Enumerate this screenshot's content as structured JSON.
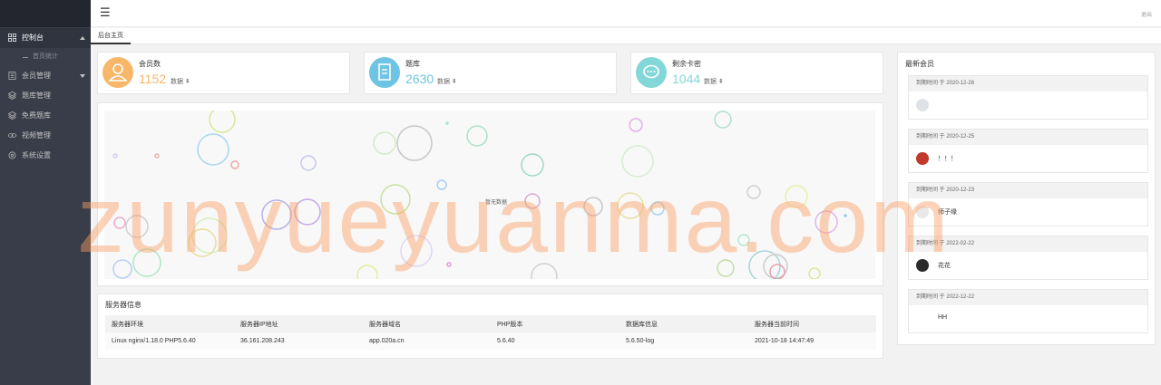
{
  "header": {
    "menu_icon": "☰",
    "logout_label": "退出"
  },
  "sidebar": {
    "items": [
      {
        "label": "控制台",
        "icon": "dashboard-icon",
        "active": true,
        "expanded": true
      },
      {
        "label": "会员管理",
        "icon": "users-icon",
        "expanded": false
      },
      {
        "label": "题库管理",
        "icon": "layers-icon"
      },
      {
        "label": "免费题库",
        "icon": "layers-icon"
      },
      {
        "label": "视频管理",
        "icon": "link-icon"
      },
      {
        "label": "系统设置",
        "icon": "gear-icon"
      }
    ],
    "sub_items": [
      {
        "label": "首页统计"
      }
    ]
  },
  "tabs": [
    {
      "label": "后台主页",
      "active": true
    }
  ],
  "stats": [
    {
      "title": "会员数",
      "value": "1152",
      "unit": "数据",
      "color": "#f7b668",
      "icon": "user-icon"
    },
    {
      "title": "题库",
      "value": "2630",
      "unit": "数据",
      "color": "#6ec4e3",
      "icon": "document-icon"
    },
    {
      "title": "剩余卡密",
      "value": "1044",
      "unit": "数据",
      "color": "#83d7d8",
      "icon": "chat-icon"
    }
  ],
  "chart": {
    "empty_text": "暂无数据"
  },
  "server": {
    "title": "服务器信息",
    "columns": [
      "服务器环境",
      "服务器IP地址",
      "服务器域名",
      "PHP版本",
      "数据库信息",
      "服务器当前时间"
    ],
    "row": [
      "Linux nginx/1.18.0 PHP5.6.40",
      "36.161.208.243",
      "app.020a.cn",
      "5.6.40",
      "5.6.50-log",
      "2021-10-18 14:47:49"
    ]
  },
  "latest_members": {
    "title": "最新会员",
    "items": [
      {
        "expire": "到期时间 于 2020-12-26",
        "name": "",
        "avatar_color": "#dfe3e8"
      },
      {
        "expire": "到期时间 于 2020-12-25",
        "name": "！！！",
        "avatar_color": "#c0392b"
      },
      {
        "expire": "到期时间 于 2020-12-23",
        "name": "师子缘",
        "avatar_color": "#e8e8e8"
      },
      {
        "expire": "到期时间 于 2022-02-22",
        "name": "花花",
        "avatar_color": "#2b2b2b"
      },
      {
        "expire": "到期时间 于 2022-12-22",
        "name": "HH",
        "avatar_color": ""
      }
    ]
  },
  "watermark": "zunyueyuanma.com"
}
